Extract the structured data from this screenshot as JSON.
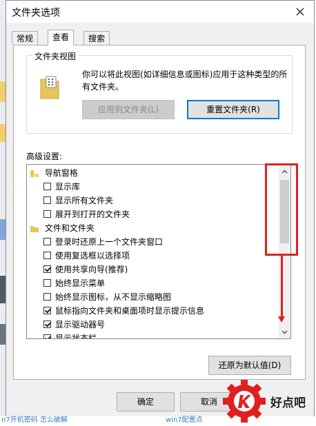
{
  "window": {
    "title": "文件夹选项"
  },
  "tabs": [
    {
      "label": "常规",
      "active": false
    },
    {
      "label": "查看",
      "active": true
    },
    {
      "label": "搜索",
      "active": false
    }
  ],
  "folder_view": {
    "title": "文件夹视图",
    "description": "你可以将此视图(如详细信息或图标)应用于这种类型的所有文件夹。",
    "apply_button": "应用到文件夹(L)",
    "reset_button": "重置文件夹(R)"
  },
  "advanced": {
    "label": "高级设置:",
    "items": [
      {
        "type": "category",
        "label": "导航窗格"
      },
      {
        "type": "checkbox",
        "label": "显示库",
        "checked": false
      },
      {
        "type": "checkbox",
        "label": "显示所有文件夹",
        "checked": false
      },
      {
        "type": "checkbox",
        "label": "展开到打开的文件夹",
        "checked": false
      },
      {
        "type": "category",
        "label": "文件和文件夹"
      },
      {
        "type": "checkbox",
        "label": "登录时还原上一个文件夹窗口",
        "checked": false
      },
      {
        "type": "checkbox",
        "label": "使用复选框以选择项",
        "checked": false
      },
      {
        "type": "checkbox",
        "label": "使用共享向导(推荐)",
        "checked": true
      },
      {
        "type": "checkbox",
        "label": "始终显示菜单",
        "checked": false
      },
      {
        "type": "checkbox",
        "label": "始终显示图标，从不显示缩略图",
        "checked": false
      },
      {
        "type": "checkbox",
        "label": "鼠标指向文件夹和桌面项时显示提示信息",
        "checked": true
      },
      {
        "type": "checkbox",
        "label": "显示驱动器号",
        "checked": true
      },
      {
        "type": "checkbox",
        "label": "显示状态栏",
        "checked": true
      }
    ],
    "restore_button": "还原为默认值(D)"
  },
  "footer": {
    "ok_button": "确定",
    "cancel_button": "取消"
  },
  "watermark": {
    "text": "好点吧"
  },
  "background_text": {
    "left": "n7开机密码 怎么破解",
    "right": "win7配置点"
  },
  "colors": {
    "accent": "#0078d7",
    "annotation": "#e02020",
    "folder": "#e8c55a"
  }
}
